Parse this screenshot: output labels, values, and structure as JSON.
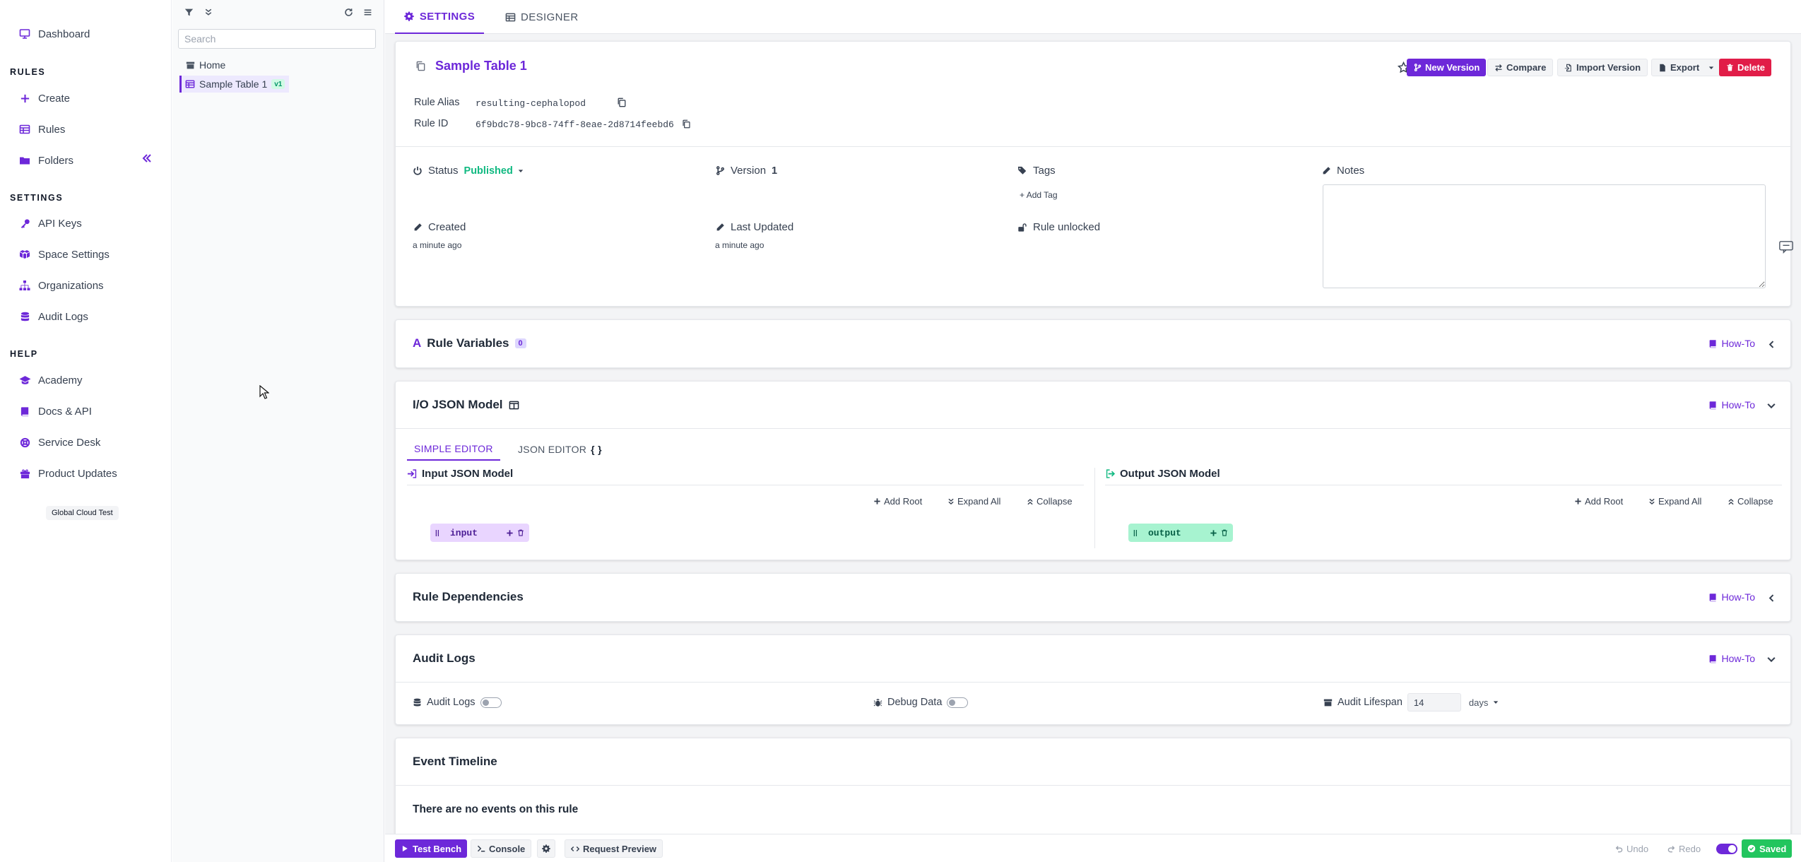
{
  "colors": {
    "accent": "#6d28d9",
    "success": "#10b981",
    "danger": "#e11d48",
    "saved": "#22c55e"
  },
  "nav": {
    "dashboard": "Dashboard",
    "rules_heading": "RULES",
    "create": "Create",
    "rules": "Rules",
    "folders": "Folders",
    "settings_heading": "SETTINGS",
    "api_keys": "API Keys",
    "space_settings": "Space Settings",
    "organizations": "Organizations",
    "audit_logs": "Audit Logs",
    "help_heading": "HELP",
    "academy": "Academy",
    "docs_api": "Docs & API",
    "service_desk": "Service Desk",
    "product_updates": "Product Updates",
    "environment_badge": "Global Cloud Test"
  },
  "tree": {
    "search_placeholder": "Search",
    "home": "Home",
    "rule_name": "Sample Table 1",
    "rule_badge": "v1"
  },
  "tabs": {
    "settings": "SETTINGS",
    "designer": "DESIGNER"
  },
  "rule": {
    "title": "Sample Table 1",
    "actions": {
      "new_version": "New Version",
      "compare": "Compare",
      "import_version": "Import Version",
      "export": "Export",
      "delete": "Delete"
    },
    "alias_label": "Rule Alias",
    "alias_value": "resulting-cephalopod",
    "id_label": "Rule ID",
    "id_value": "6f9bdc78-9bc8-74ff-8eae-2d8714feebd6",
    "status_label": "Status",
    "status_value": "Published",
    "version_label": "Version",
    "version_value": "1",
    "tags_label": "Tags",
    "add_tag": "Add Tag",
    "notes_label": "Notes",
    "created_label": "Created",
    "created_value": "a minute ago",
    "updated_label": "Last Updated",
    "updated_value": "a minute ago",
    "lock_status": "Rule unlocked"
  },
  "sections": {
    "howto": "How-To",
    "variables_title": "Rule Variables",
    "variables_count": "0",
    "io_title": "I/O JSON Model",
    "dependencies_title": "Rule Dependencies",
    "audit_title": "Audit Logs",
    "events_title": "Event Timeline",
    "events_empty": "There are no events on this rule"
  },
  "io": {
    "simple_editor": "SIMPLE EDITOR",
    "json_editor": "JSON EDITOR",
    "json_editor_icon": "{ }",
    "input_title": "Input JSON Model",
    "output_title": "Output JSON Model",
    "add_root": "Add Root",
    "expand_all": "Expand All",
    "collapse": "Collapse",
    "input_node": "input",
    "output_node": "output"
  },
  "audit": {
    "audit_logs_label": "Audit Logs",
    "debug_data_label": "Debug Data",
    "lifespan_label": "Audit Lifespan",
    "lifespan_value": "14",
    "lifespan_unit": "days"
  },
  "bottom": {
    "test_bench": "Test Bench",
    "console": "Console",
    "request_preview": "Request Preview",
    "undo": "Undo",
    "redo": "Redo",
    "saved": "Saved"
  }
}
